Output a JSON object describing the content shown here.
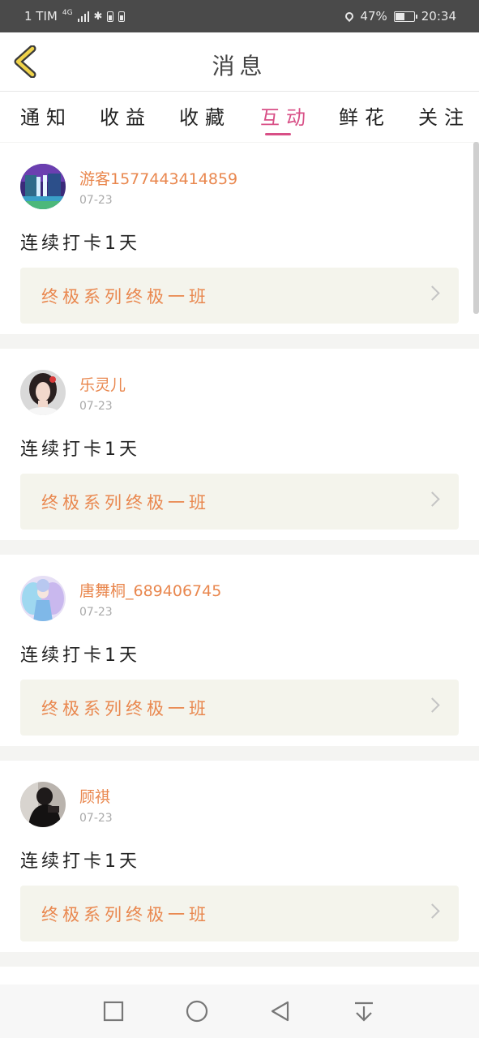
{
  "status_bar": {
    "carrier": "1 TIM",
    "network": "4G",
    "battery_percent": "47%",
    "time": "20:34"
  },
  "header": {
    "title": "消息",
    "back_icon": "chevron-left-icon",
    "accent_color": "#f0d34a"
  },
  "tabs": [
    {
      "label": "通知",
      "active": false
    },
    {
      "label": "收益",
      "active": false
    },
    {
      "label": "收藏",
      "active": false
    },
    {
      "label": "互动",
      "active": true
    },
    {
      "label": "鲜花",
      "active": false
    },
    {
      "label": "关注",
      "active": false
    }
  ],
  "colors": {
    "active_tab": "#d84f86",
    "username": "#e9874e",
    "link_bg": "#f4f4ec"
  },
  "messages": [
    {
      "username": "游客15774434148​59",
      "date": "07-23",
      "text": "连续打卡1天",
      "class_link": "终极系列终极一班",
      "avatar": "waterfall-landscape"
    },
    {
      "username": "乐灵儿",
      "date": "07-23",
      "text": "连续打卡1天",
      "class_link": "终极系列终极一班",
      "avatar": "woman-portrait"
    },
    {
      "username": "唐舞桐_689406745",
      "date": "07-23",
      "text": "连续打卡1天",
      "class_link": "终极系列终极一班",
      "avatar": "anime-character"
    },
    {
      "username": "顾祺",
      "date": "07-23",
      "text": "连续打卡1天",
      "class_link": "终极系列终极一班",
      "avatar": "dark-silhouette"
    }
  ],
  "bottom_nav": [
    "square-icon",
    "circle-icon",
    "triangle-back-icon",
    "download-icon"
  ]
}
